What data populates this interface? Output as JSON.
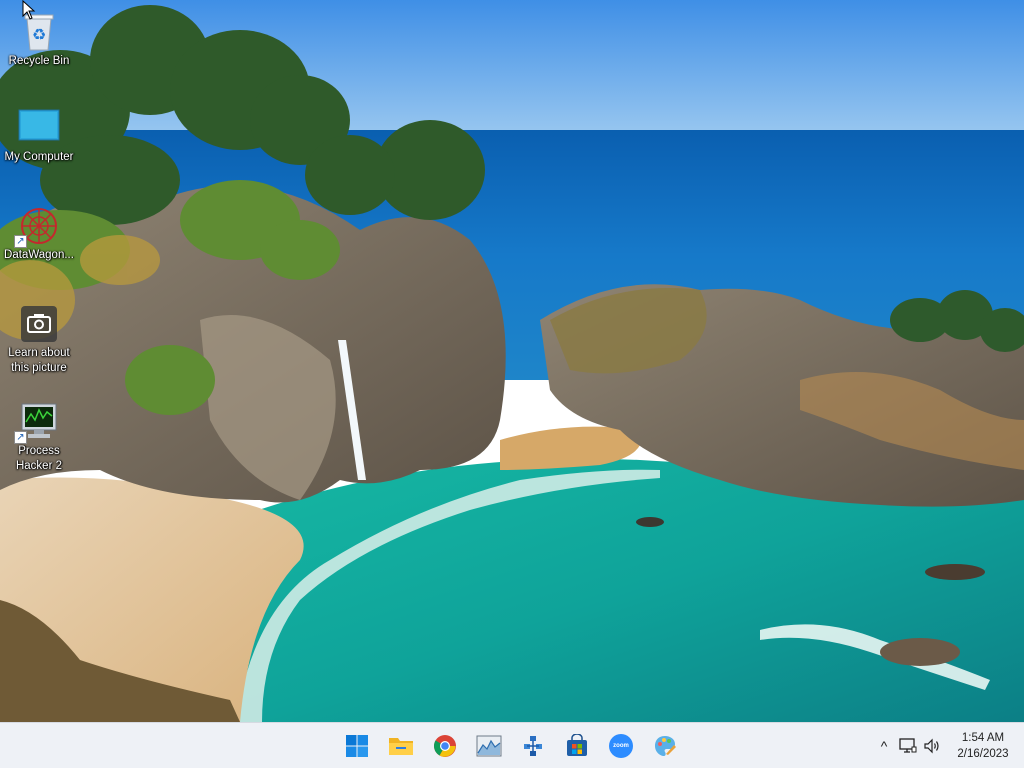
{
  "desktop": {
    "icons": [
      {
        "label": "Recycle Bin",
        "icon": "recycle-bin-icon"
      },
      {
        "label": "My Computer",
        "icon": "monitor-icon"
      },
      {
        "label": "DataWagon...",
        "icon": "datawagon-icon",
        "shortcut": true
      },
      {
        "label": "Learn about this picture",
        "icon": "camera-icon"
      },
      {
        "label": "Process Hacker 2",
        "icon": "process-hacker-icon",
        "shortcut": true
      }
    ]
  },
  "taskbar": {
    "apps": [
      {
        "name": "Start",
        "icon": "windows-start-icon"
      },
      {
        "name": "File Explorer",
        "icon": "folder-icon"
      },
      {
        "name": "Google Chrome",
        "icon": "chrome-icon"
      },
      {
        "name": "Performance Monitor",
        "icon": "performance-monitor-icon"
      },
      {
        "name": "Network Tool",
        "icon": "network-tool-icon"
      },
      {
        "name": "Microsoft Store",
        "icon": "store-icon"
      },
      {
        "name": "Zoom",
        "icon": "zoom-icon",
        "text": "zoom"
      },
      {
        "name": "Paint",
        "icon": "paint-icon"
      }
    ],
    "tray": {
      "overflow_glyph": "^",
      "time": "1:54 AM",
      "date": "2/16/2023"
    }
  },
  "colors": {
    "taskbar_bg": "#eef1f6",
    "accent": "#0078d4",
    "zoom_blue": "#2d8cff"
  }
}
